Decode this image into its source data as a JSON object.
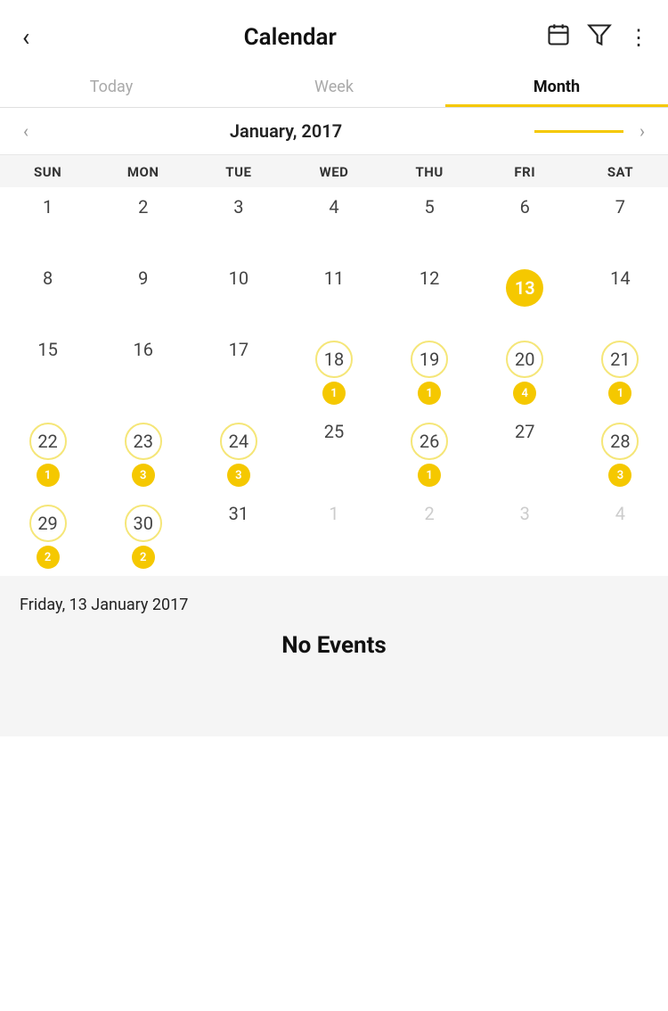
{
  "header": {
    "back_label": "‹",
    "title": "Calendar",
    "icons": {
      "calendar": "calendar-icon",
      "filter": "filter-icon",
      "more": "more-icon"
    }
  },
  "tabs": [
    {
      "id": "today",
      "label": "Today",
      "active": false
    },
    {
      "id": "week",
      "label": "Week",
      "active": false
    },
    {
      "id": "month",
      "label": "Month",
      "active": true
    }
  ],
  "month_nav": {
    "prev_label": "‹",
    "next_label": "›",
    "title": "January, 2017"
  },
  "day_headers": [
    "SUN",
    "MON",
    "TUE",
    "WED",
    "THU",
    "FRI",
    "SAT"
  ],
  "weeks": [
    [
      {
        "day": 1,
        "month": "current",
        "events": 0,
        "today": false
      },
      {
        "day": 2,
        "month": "current",
        "events": 0,
        "today": false
      },
      {
        "day": 3,
        "month": "current",
        "events": 0,
        "today": false
      },
      {
        "day": 4,
        "month": "current",
        "events": 0,
        "today": false
      },
      {
        "day": 5,
        "month": "current",
        "events": 0,
        "today": false
      },
      {
        "day": 6,
        "month": "current",
        "events": 0,
        "today": false
      },
      {
        "day": 7,
        "month": "current",
        "events": 0,
        "today": false
      }
    ],
    [
      {
        "day": 8,
        "month": "current",
        "events": 0,
        "today": false
      },
      {
        "day": 9,
        "month": "current",
        "events": 0,
        "today": false
      },
      {
        "day": 10,
        "month": "current",
        "events": 0,
        "today": false
      },
      {
        "day": 11,
        "month": "current",
        "events": 0,
        "today": false
      },
      {
        "day": 12,
        "month": "current",
        "events": 0,
        "today": false
      },
      {
        "day": 13,
        "month": "current",
        "events": 0,
        "today": true
      },
      {
        "day": 14,
        "month": "current",
        "events": 0,
        "today": false
      }
    ],
    [
      {
        "day": 15,
        "month": "current",
        "events": 0,
        "today": false
      },
      {
        "day": 16,
        "month": "current",
        "events": 0,
        "today": false
      },
      {
        "day": 17,
        "month": "current",
        "events": 0,
        "today": false
      },
      {
        "day": 18,
        "month": "current",
        "events": 1,
        "today": false
      },
      {
        "day": 19,
        "month": "current",
        "events": 1,
        "today": false
      },
      {
        "day": 20,
        "month": "current",
        "events": 4,
        "today": false
      },
      {
        "day": 21,
        "month": "current",
        "events": 1,
        "today": false
      }
    ],
    [
      {
        "day": 22,
        "month": "current",
        "events": 1,
        "today": false
      },
      {
        "day": 23,
        "month": "current",
        "events": 3,
        "today": false
      },
      {
        "day": 24,
        "month": "current",
        "events": 3,
        "today": false
      },
      {
        "day": 25,
        "month": "current",
        "events": 0,
        "today": false
      },
      {
        "day": 26,
        "month": "current",
        "events": 1,
        "today": false
      },
      {
        "day": 27,
        "month": "current",
        "events": 0,
        "today": false
      },
      {
        "day": 28,
        "month": "current",
        "events": 3,
        "today": false
      }
    ],
    [
      {
        "day": 29,
        "month": "current",
        "events": 2,
        "today": false
      },
      {
        "day": 30,
        "month": "current",
        "events": 2,
        "today": false
      },
      {
        "day": 31,
        "month": "current",
        "events": 0,
        "today": false
      },
      {
        "day": 1,
        "month": "next",
        "events": 0,
        "today": false
      },
      {
        "day": 2,
        "month": "next",
        "events": 0,
        "today": false
      },
      {
        "day": 3,
        "month": "next",
        "events": 0,
        "today": false
      },
      {
        "day": 4,
        "month": "next",
        "events": 0,
        "today": false
      }
    ]
  ],
  "selected_section": {
    "date_label": "Friday, 13 January 2017",
    "no_events_label": "No Events"
  }
}
